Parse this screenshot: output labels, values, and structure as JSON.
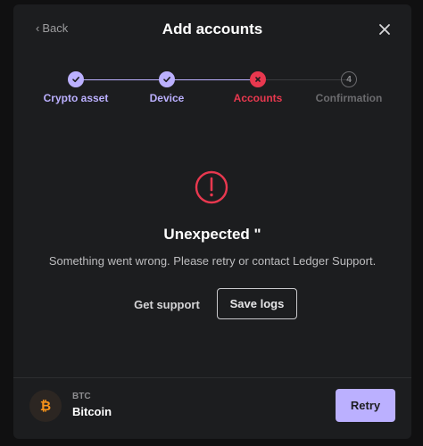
{
  "header": {
    "back_label": "Back",
    "title": "Add accounts"
  },
  "stepper": {
    "steps": [
      {
        "label": "Crypto asset",
        "state": "done"
      },
      {
        "label": "Device",
        "state": "done"
      },
      {
        "label": "Accounts",
        "state": "error"
      },
      {
        "label": "Confirmation",
        "state": "pending",
        "number": "4"
      }
    ]
  },
  "error": {
    "title": "Unexpected \"",
    "description": "Something went wrong. Please retry or contact Ledger Support."
  },
  "actions": {
    "get_support_label": "Get support",
    "save_logs_label": "Save logs"
  },
  "footer": {
    "coin_ticker": "BTC",
    "coin_name": "Bitcoin",
    "retry_label": "Retry"
  },
  "colors": {
    "accent_purple": "#bbb0ff",
    "error_red": "#e8384f",
    "bitcoin_orange": "#f7931a",
    "modal_bg": "#1c1d1f",
    "pending_gray": "#6b6b6e"
  }
}
